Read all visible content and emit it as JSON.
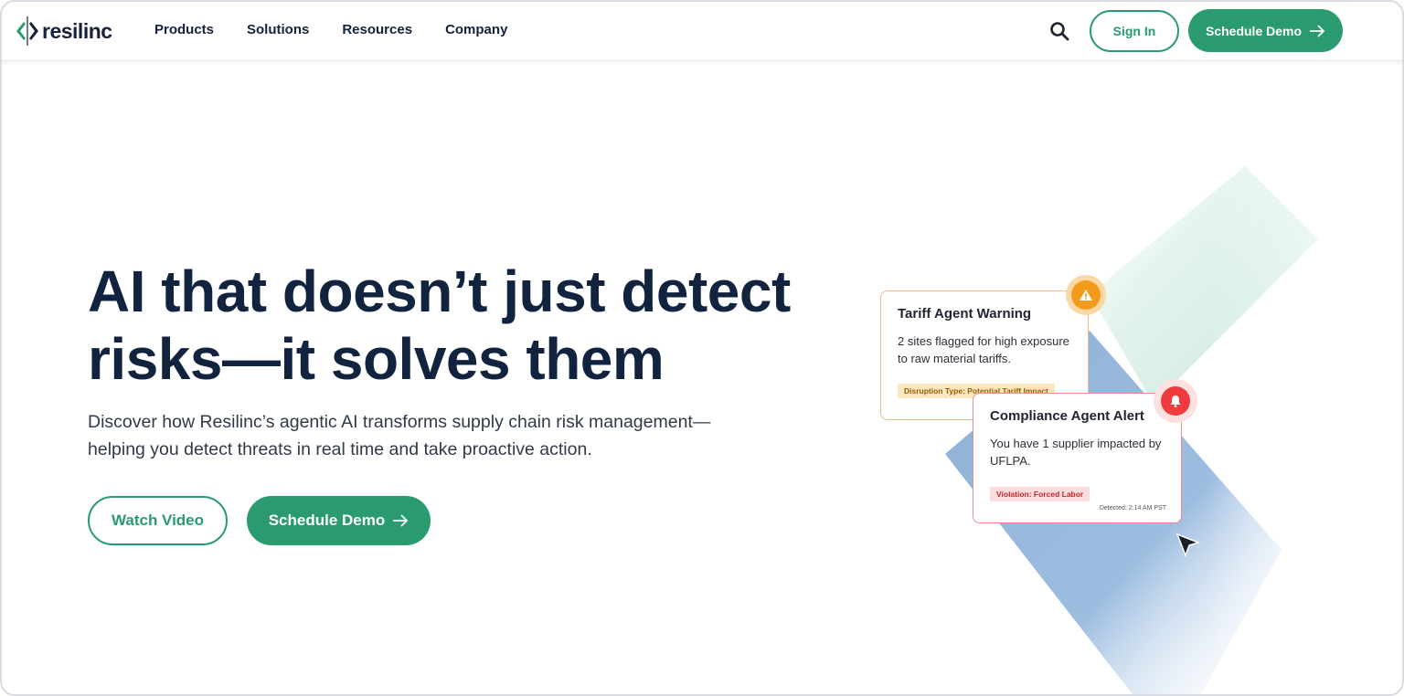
{
  "brand": {
    "name": "resilinc",
    "accent": "#2a9a6f",
    "dark_text": "#12233f"
  },
  "nav": {
    "items": [
      "Products",
      "Solutions",
      "Resources",
      "Company"
    ],
    "search_icon": "search-icon",
    "sign_in": "Sign In",
    "schedule_demo": "Schedule Demo"
  },
  "hero": {
    "title_line1": "AI that doesn’t just detect",
    "title_line2": "risks—it solves them",
    "subtitle_line1": "Discover how Resilinc’s agentic AI transforms supply chain risk management—",
    "subtitle_line2": "helping you detect threats in real time and take proactive action.",
    "watch_video": "Watch Video",
    "schedule_demo": "Schedule Demo"
  },
  "cards": {
    "tariff": {
      "title": "Tariff Agent Warning",
      "body": "2 sites flagged for high exposure to raw material tariffs.",
      "tag": "Disruption Type: Potential Tariff Impact",
      "icon": "warning-icon"
    },
    "compliance": {
      "title": "Compliance Agent Alert",
      "body": "You have 1 supplier impacted by UFLPA.",
      "tag": "Violation: Forced Labor",
      "detected": "Detected: 2:14 AM PST",
      "icon": "bell-icon"
    }
  }
}
